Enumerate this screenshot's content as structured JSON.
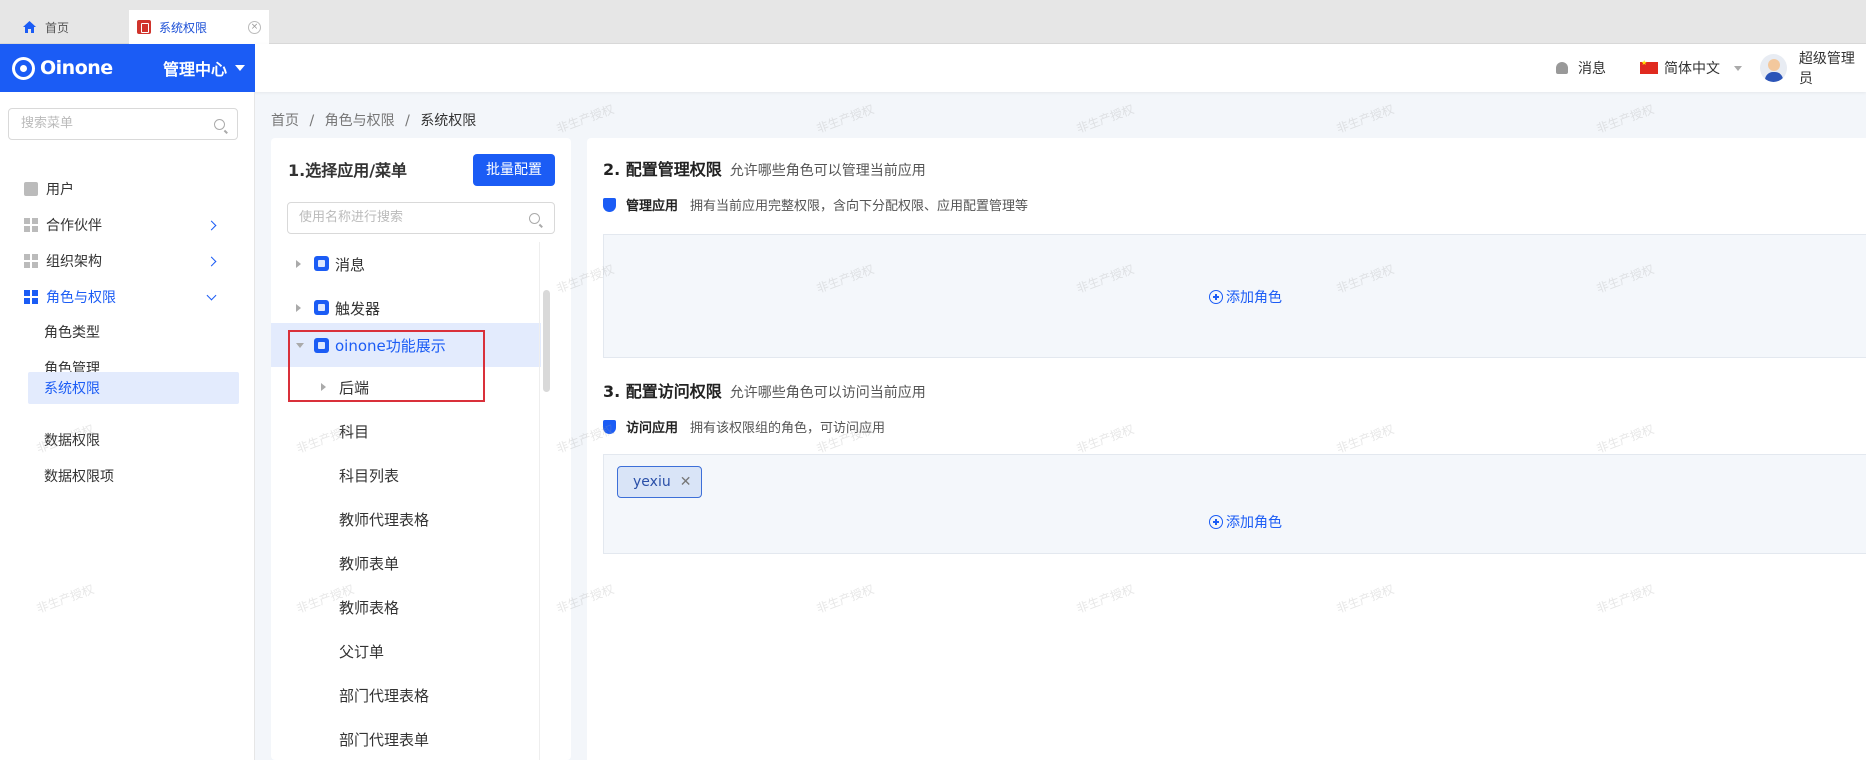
{
  "tabs": [
    {
      "label": "首页",
      "icon": "home-icon"
    },
    {
      "label": "系统权限",
      "icon": "permission-app-icon",
      "close": "×"
    }
  ],
  "header": {
    "logo_text": "Oinone",
    "center_title": "管理中心",
    "messages_label": "消息",
    "language_label": "简体中文",
    "user_name": "超级管理员"
  },
  "sidebar": {
    "search_placeholder": "搜索菜单",
    "items": [
      {
        "label": "用户",
        "icon": "folder-icon"
      },
      {
        "label": "合作伙伴",
        "icon": "grid-icon"
      },
      {
        "label": "组织架构",
        "icon": "grid-icon"
      },
      {
        "label": "角色与权限",
        "icon": "grid-icon"
      }
    ],
    "sub_items": [
      {
        "label": "角色类型"
      },
      {
        "label": "角色管理"
      },
      {
        "label": "系统权限",
        "active": true
      },
      {
        "label": "数据权限"
      },
      {
        "label": "数据权限项"
      }
    ]
  },
  "breadcrumb": {
    "home": "首页",
    "sep1": "/",
    "parent": "角色与权限",
    "sep2": "/",
    "current": "系统权限"
  },
  "left_panel": {
    "title": "1.选择应用/菜单",
    "batch_button": "批量配置",
    "search_placeholder": "使用名称进行搜索",
    "tree": [
      {
        "label": "消息",
        "level": 0,
        "expanded": false
      },
      {
        "label": "触发器",
        "level": 0,
        "expanded": false
      },
      {
        "label": "oinone功能展示",
        "level": 0,
        "expanded": true,
        "selected": true
      },
      {
        "label": "后端",
        "level": 1,
        "expanded": false
      },
      {
        "label": "科目",
        "level": 1
      },
      {
        "label": "科目列表",
        "level": 1
      },
      {
        "label": "教师代理表格",
        "level": 1
      },
      {
        "label": "教师表单",
        "level": 1
      },
      {
        "label": "教师表格",
        "level": 1
      },
      {
        "label": "父订单",
        "level": 1
      },
      {
        "label": "部门代理表格",
        "level": 1
      },
      {
        "label": "部门代理表单",
        "level": 1
      }
    ]
  },
  "manage_section": {
    "title": "2. 配置管理权限",
    "desc": "允许哪些角色可以管理当前应用",
    "label": "管理应用",
    "label_desc": "拥有当前应用完整权限，含向下分配权限、应用配置管理等",
    "add_role": "添加角色"
  },
  "access_section": {
    "title": "3. 配置访问权限",
    "desc": "允许哪些角色可以访问当前应用",
    "label": "访问应用",
    "label_desc": "拥有该权限组的角色，可访问应用",
    "tags": [
      {
        "label": "yexiu",
        "close": "✕"
      }
    ],
    "add_role": "添加角色"
  },
  "watermark": "非生产授权",
  "colors": {
    "primary": "#1b5cf5",
    "highlight": "#d9303a"
  }
}
